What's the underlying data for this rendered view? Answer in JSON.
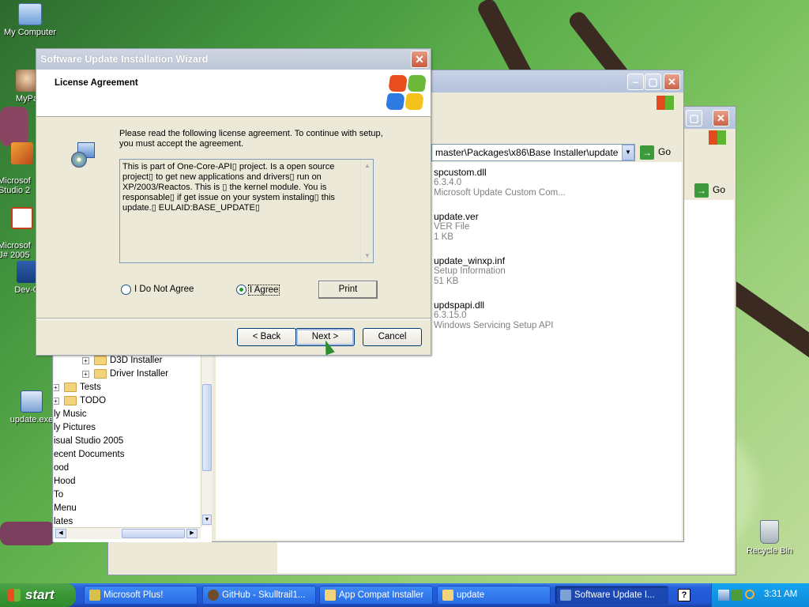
{
  "desktop": {
    "icons": [
      {
        "label": "My Computer"
      },
      {
        "label": "MyPa"
      },
      {
        "label": "Microsof\nStudio 2"
      },
      {
        "label": "Microsof\nJ# 2005"
      },
      {
        "label": "Dev-C"
      },
      {
        "label": "update.exe"
      },
      {
        "label": "Recycle Bin"
      }
    ]
  },
  "explorer_back": {
    "address": "master\\Packages\\x86\\Base Installer\\update",
    "go_label": "Go",
    "go_label2": "Go",
    "files": [
      {
        "name": "spcustom.dll",
        "line2": "6.3.4.0",
        "line3": "Microsoft Update Custom Com..."
      },
      {
        "name": "update.ver",
        "line2": "VER File",
        "line3": "1 KB"
      },
      {
        "name": "update_winxp.inf",
        "line2": "Setup Information",
        "line3": "51 KB"
      },
      {
        "name": "updspapi.dll",
        "line2": "6.3.15.0",
        "line3": "Windows Servicing Setup API"
      }
    ],
    "tree": [
      {
        "label": "D3D Installer"
      },
      {
        "label": "Driver Installer"
      },
      {
        "label": "Tests"
      },
      {
        "label": "TODO"
      },
      {
        "label": "ly Music"
      },
      {
        "label": "ly Pictures"
      },
      {
        "label": "isual Studio 2005"
      },
      {
        "label": "ecent Documents"
      },
      {
        "label": "ood"
      },
      {
        "label": "Hood"
      },
      {
        "label": "To"
      },
      {
        "label": "Menu"
      },
      {
        "label": "lates"
      }
    ]
  },
  "dialog": {
    "title": "Software Update Installation Wizard",
    "header": "License Agreement",
    "intro": "Please read the following license agreement. To continue with setup, you must accept the agreement.",
    "license_text": "This is part of One-Core-API▯ project. Is a open source project▯ to get new applications and drivers▯ run on XP/2003/Reactos. This is ▯ the kernel module. You is responsable▯ if get issue on your system instaling▯ this update.▯ EULAID:BASE_UPDATE▯",
    "radio_disagree": "I Do Not Agree",
    "radio_agree": "I Agree",
    "selected": "I Agree",
    "print": "Print",
    "back": "< Back",
    "next": "Next >",
    "cancel": "Cancel"
  },
  "taskbar": {
    "start": "start",
    "tasks": [
      {
        "label": "Microsoft Plus!"
      },
      {
        "label": "GitHub - Skulltrail1..."
      },
      {
        "label": "App Compat Installer"
      },
      {
        "label": "update"
      },
      {
        "label": "Software Update I..."
      }
    ],
    "help": "?",
    "clock": "3:31 AM"
  }
}
